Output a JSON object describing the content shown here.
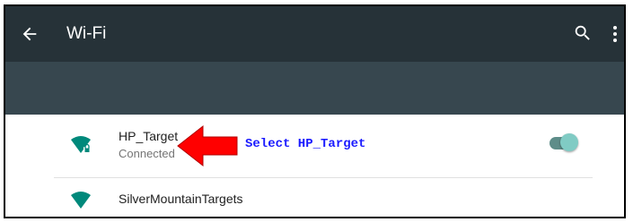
{
  "toolbar": {
    "title": "Wi-Fi",
    "background": "#263238",
    "icons": [
      "back-arrow-icon",
      "search-icon",
      "more-vert-icon"
    ]
  },
  "wifi_toggle": {
    "label": "On",
    "enabled": true,
    "accent": "#80cbc4"
  },
  "networks": [
    {
      "ssid": "HP_Target",
      "status": "Connected",
      "secured": true
    },
    {
      "ssid": "SilverMountainTargets",
      "secured": false
    }
  ],
  "annotation": {
    "text": "Select HP_Target",
    "text_color": "#1a1aff",
    "arrow_color": "#ff0000"
  }
}
